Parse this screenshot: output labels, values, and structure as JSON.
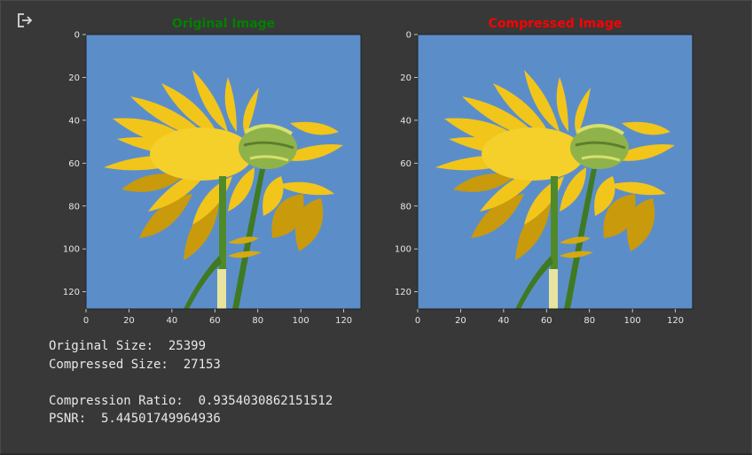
{
  "output_icon": "output-arrow-icon",
  "colors": {
    "background": "#383838",
    "axis_text": "#e6e6e6",
    "sky": "#5b8ec9",
    "petal": "#f2c51a",
    "petal_shade": "#c99a0c",
    "stem": "#4f8a2a",
    "center": "#8fb34a",
    "original_title": "#008000",
    "compressed_title": "#ff0000"
  },
  "subplots": [
    {
      "title": "Original Image",
      "title_color": "#008000",
      "xticks": [
        "0",
        "20",
        "40",
        "60",
        "80",
        "100",
        "120"
      ],
      "yticks": [
        "0",
        "20",
        "40",
        "60",
        "80",
        "100",
        "120"
      ]
    },
    {
      "title": "Compressed Image",
      "title_color": "#ff0000",
      "xticks": [
        "0",
        "20",
        "40",
        "60",
        "80",
        "100",
        "120"
      ],
      "yticks": [
        "0",
        "20",
        "40",
        "60",
        "80",
        "100",
        "120"
      ]
    }
  ],
  "output": {
    "lines": [
      "Original Size:  25399",
      "Compressed Size:  27153",
      "",
      "Compression Ratio:  0.9354030862151512",
      "PSNR:  5.44501749964936"
    ]
  }
}
